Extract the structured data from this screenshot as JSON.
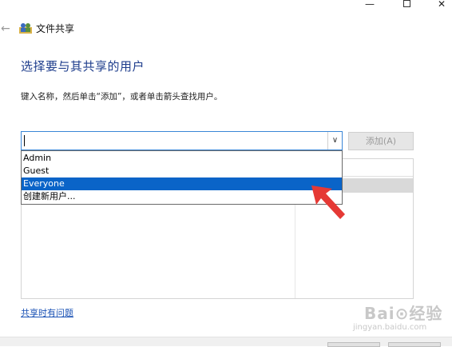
{
  "window": {
    "title": "文件共享",
    "minimize_glyph": "—",
    "close_glyph": "✕"
  },
  "page": {
    "heading": "选择要与其共享的用户",
    "instruction": "键入名称，然后单击“添加”，或者单击箭头查找用户。",
    "add_button_label": "添加(A)",
    "trouble_link": "共享时有问题"
  },
  "combo": {
    "value": "",
    "arrow_glyph": "∨"
  },
  "dropdown": {
    "options": [
      "Admin",
      "Guest",
      "Everyone",
      "创建新用户..."
    ],
    "selected_index": 2
  },
  "watermark": {
    "text": "Bai⊙经验",
    "sub": "jingyan.baidu.com"
  },
  "colors": {
    "accent": "#1e3d8c",
    "selection": "#0a64c8",
    "annotation_arrow": "#e53935"
  },
  "icons": {
    "back": "back-arrow-icon",
    "app": "users-share-icon",
    "combo_arrow": "chevron-down-icon"
  }
}
